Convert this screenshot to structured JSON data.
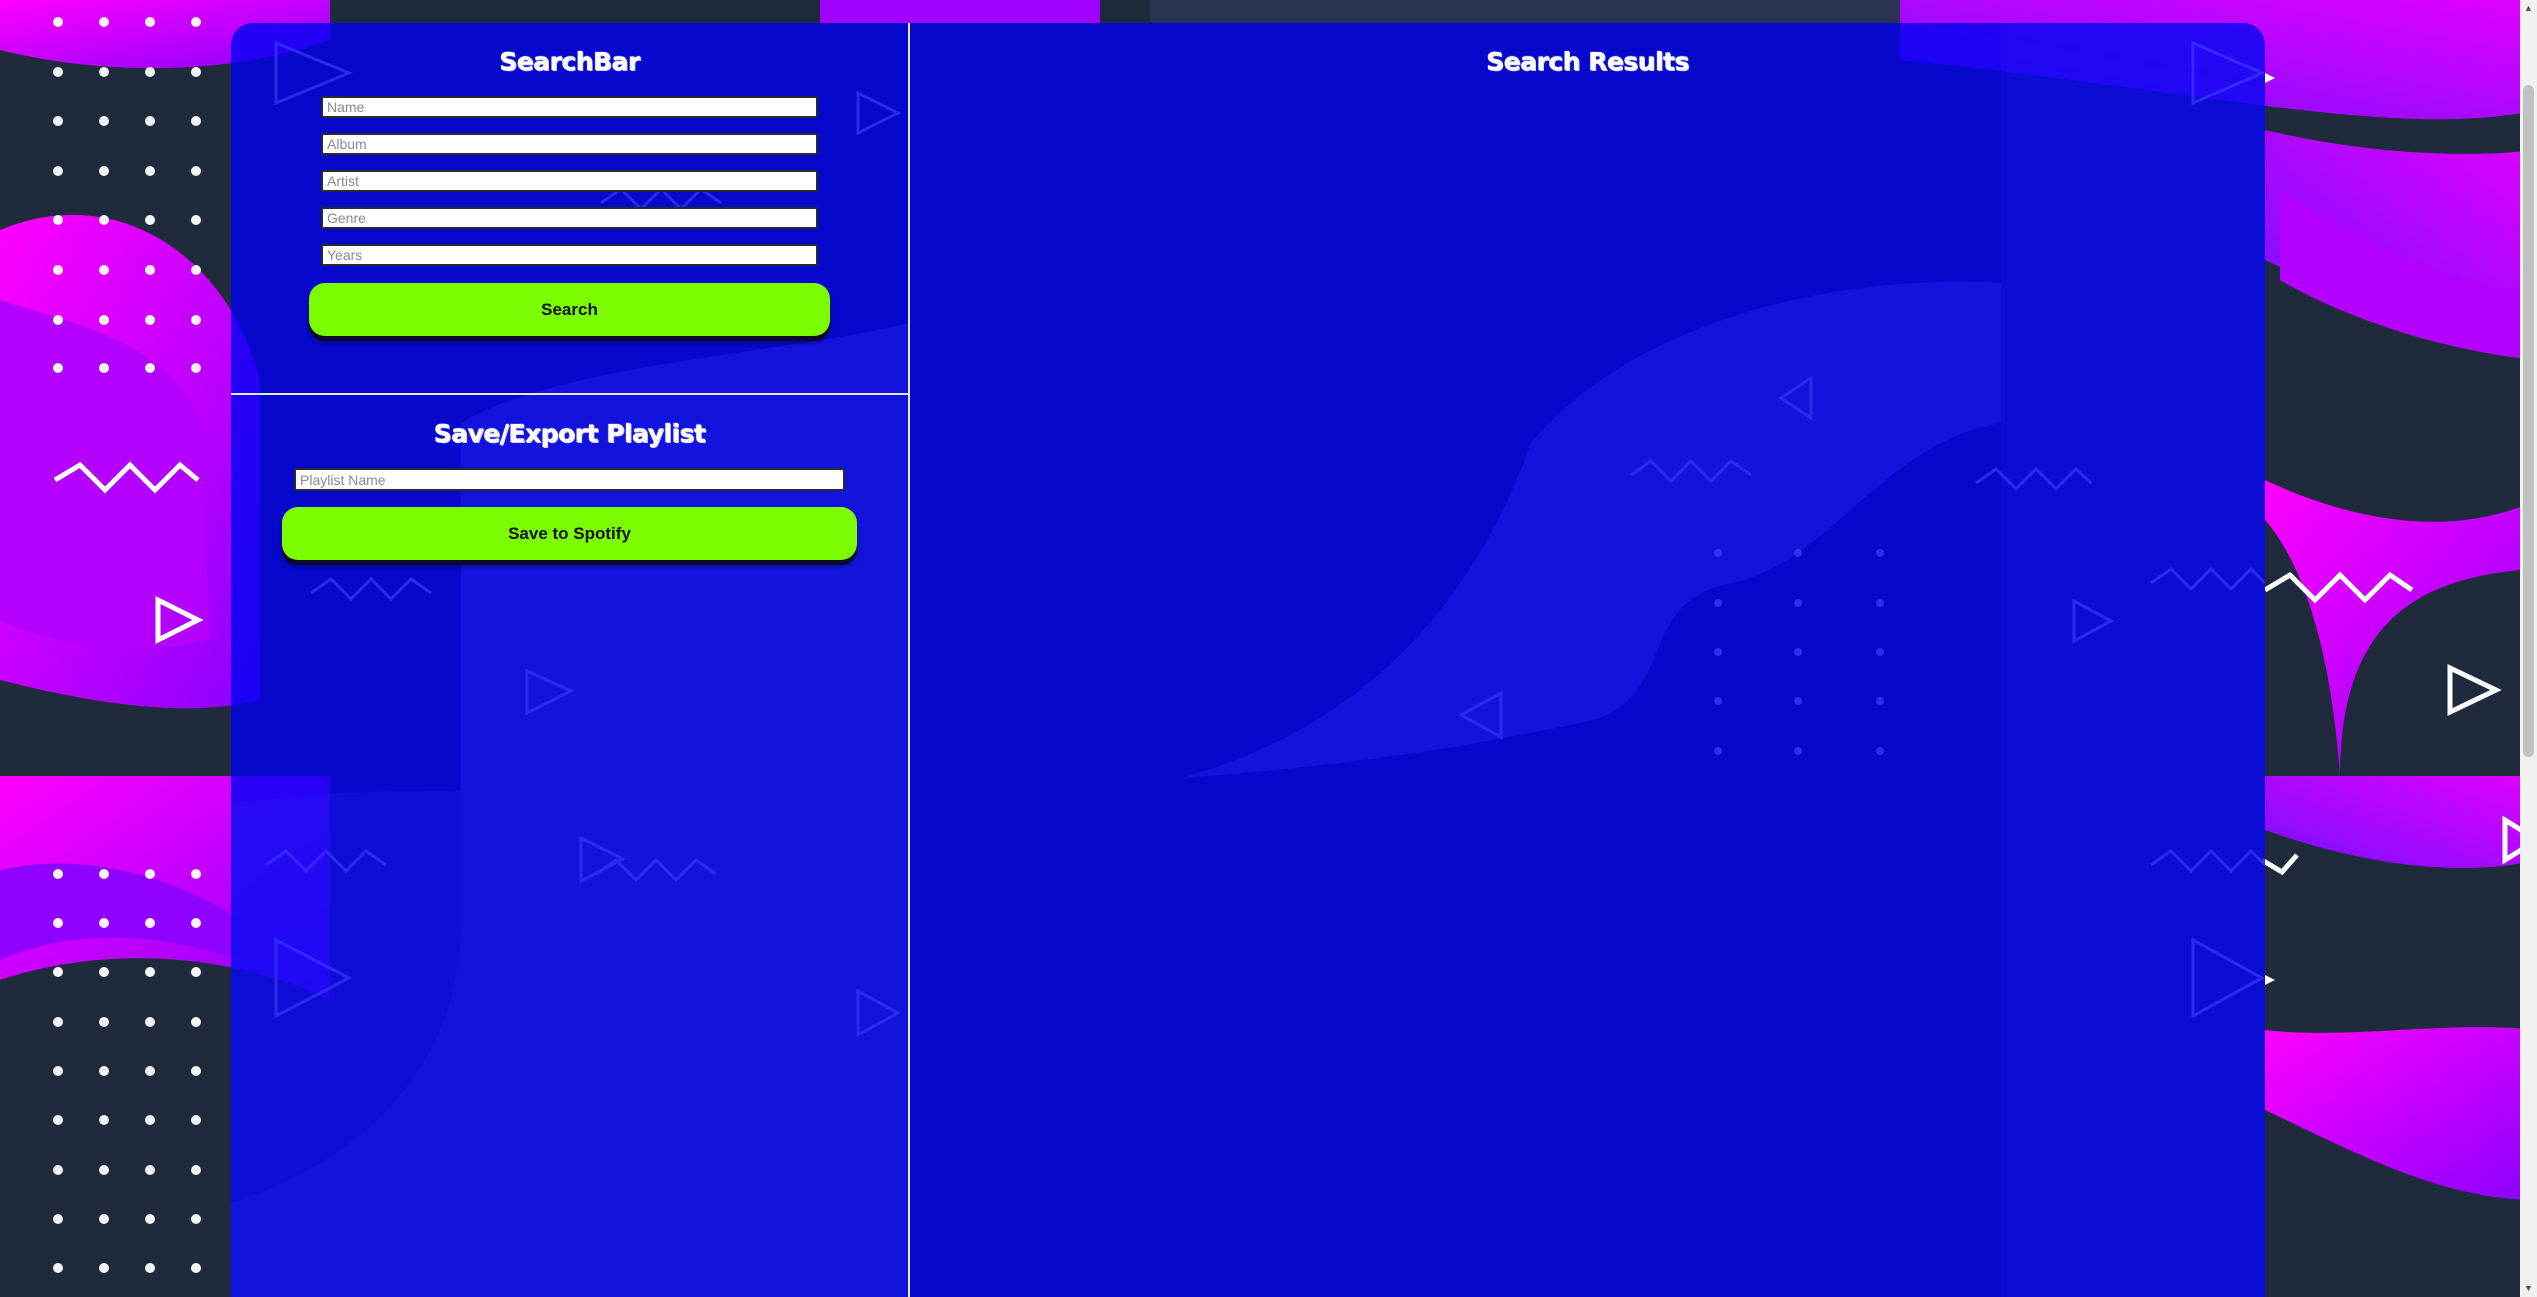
{
  "search_bar": {
    "title": "SearchBar",
    "fields": [
      {
        "name": "name",
        "placeholder": "Name",
        "value": ""
      },
      {
        "name": "album",
        "placeholder": "Album",
        "value": ""
      },
      {
        "name": "artist",
        "placeholder": "Artist",
        "value": ""
      },
      {
        "name": "genre",
        "placeholder": "Genre",
        "value": ""
      },
      {
        "name": "years",
        "placeholder": "Years",
        "value": ""
      }
    ],
    "button_label": "Search"
  },
  "playlist": {
    "title": "Save/Export Playlist",
    "name_placeholder": "Playlist Name",
    "name_value": "",
    "button_label": "Save to Spotify"
  },
  "results": {
    "title": "Search Results",
    "items": []
  },
  "colors": {
    "panel": "#0000f0",
    "button": "#7cfc00",
    "background_magenta": "#e600ff",
    "background_dark": "#1f2a3c"
  },
  "icons": [
    "play-triangle-icon",
    "zigzag-icon",
    "dot-grid-icon",
    "scroll-up-arrow-icon",
    "scroll-down-arrow-icon"
  ]
}
